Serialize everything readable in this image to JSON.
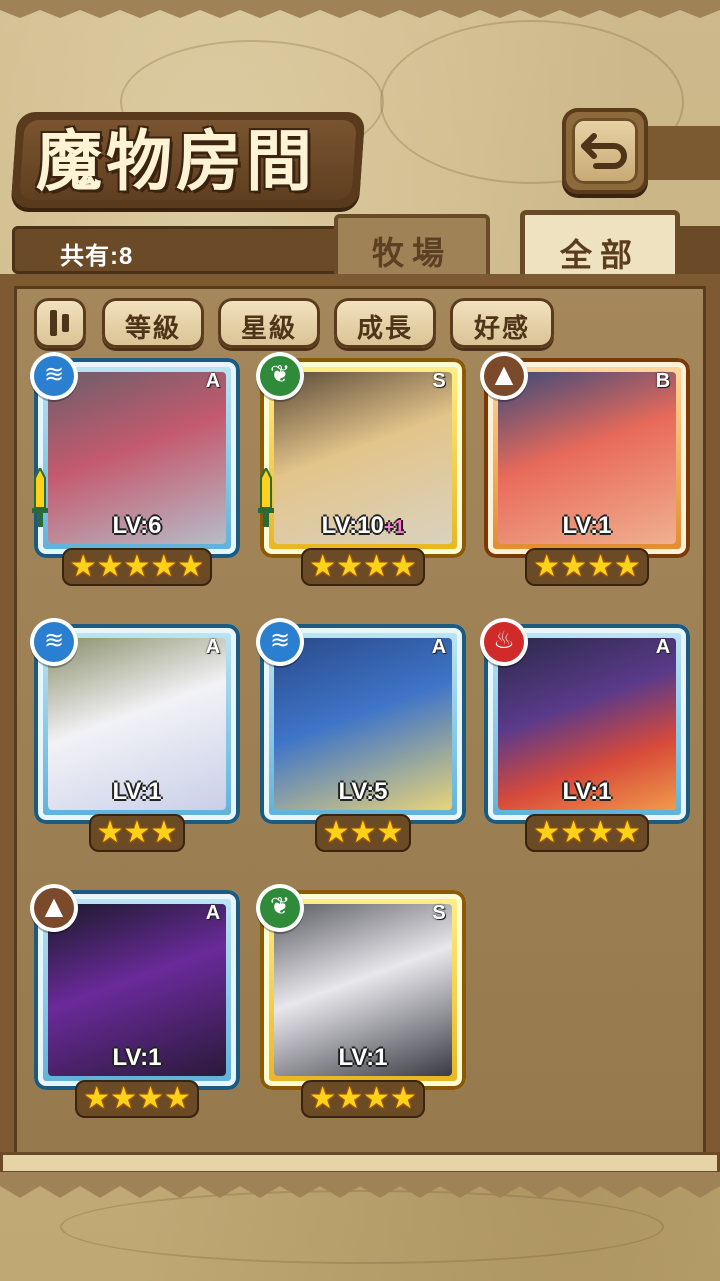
{
  "screen": {
    "title": "魔物房間",
    "count_label": "共有:8",
    "tabs": [
      {
        "label": "牧場",
        "active": false
      },
      {
        "label": "全部",
        "active": true
      }
    ],
    "filters": [
      {
        "label": "等級"
      },
      {
        "label": "星級"
      },
      {
        "label": "成長"
      },
      {
        "label": "好感"
      }
    ],
    "icons": {
      "back": "back-return-icon",
      "sort": "sort-toggle-icon"
    }
  },
  "colors": {
    "blue_frame": "#5db0d8",
    "gold_frame": "#e6b41e",
    "orange_frame": "#e08a2c",
    "water": "#2a7fd0",
    "wood": "#2f8a3a",
    "earth": "#7a4a2a",
    "fire": "#d02a2a"
  },
  "monsters": [
    {
      "rank": "A",
      "element": "water",
      "level": "LV:6",
      "level_bonus": "",
      "stars": 5,
      "frame": "blue",
      "equipped": true,
      "stars_text": "★★★★★"
    },
    {
      "rank": "S",
      "element": "wood",
      "level": "LV:10",
      "level_bonus": "+1",
      "stars": 4,
      "frame": "gold",
      "equipped": true,
      "stars_text": "★★★★"
    },
    {
      "rank": "B",
      "element": "earth",
      "level": "LV:1",
      "level_bonus": "",
      "stars": 4,
      "frame": "orange",
      "equipped": false,
      "stars_text": "★★★★"
    },
    {
      "rank": "A",
      "element": "water",
      "level": "LV:1",
      "level_bonus": "",
      "stars": 3,
      "frame": "blue",
      "equipped": false,
      "stars_text": "★★★"
    },
    {
      "rank": "A",
      "element": "water",
      "level": "LV:5",
      "level_bonus": "",
      "stars": 3,
      "frame": "blue",
      "equipped": false,
      "stars_text": "★★★"
    },
    {
      "rank": "A",
      "element": "fire",
      "level": "LV:1",
      "level_bonus": "",
      "stars": 4,
      "frame": "blue",
      "equipped": false,
      "stars_text": "★★★★"
    },
    {
      "rank": "A",
      "element": "earth",
      "level": "LV:1",
      "level_bonus": "",
      "stars": 4,
      "frame": "blue",
      "equipped": false,
      "stars_text": "★★★★"
    },
    {
      "rank": "S",
      "element": "wood",
      "level": "LV:1",
      "level_bonus": "",
      "stars": 4,
      "frame": "gold",
      "equipped": false,
      "stars_text": "★★★★"
    }
  ]
}
